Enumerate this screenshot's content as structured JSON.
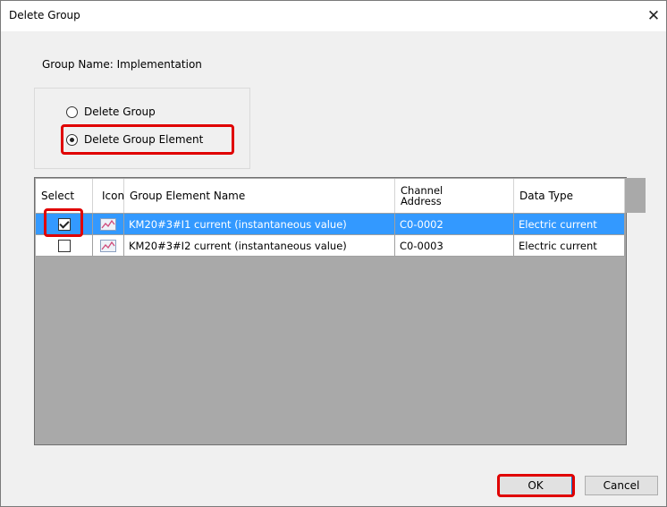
{
  "dialog": {
    "title": "Delete Group",
    "close_glyph": "✕"
  },
  "group_name_label": "Group Name: Implementation",
  "options": {
    "delete_group": "Delete Group",
    "delete_group_element": "Delete Group Element",
    "selected": "delete_group_element"
  },
  "table": {
    "headers": {
      "select": "Select",
      "icon": "Icon",
      "name": "Group Element Name",
      "address_line1": "Channel",
      "address_line2": "Address",
      "type": "Data Type"
    },
    "rows": [
      {
        "checked": true,
        "icon": "trend-chart-icon",
        "name": "KM20#3#I1 current (instantaneous value)",
        "address": "C0-0002",
        "type": "Electric current"
      },
      {
        "checked": false,
        "icon": "trend-chart-icon",
        "name": "KM20#3#I2 current (instantaneous value)",
        "address": "C0-0003",
        "type": "Electric current"
      }
    ]
  },
  "buttons": {
    "ok": "OK",
    "cancel": "Cancel"
  },
  "colors": {
    "selection": "#3399ff",
    "highlight": "#e00000",
    "grid_background": "#a9a9a9"
  }
}
